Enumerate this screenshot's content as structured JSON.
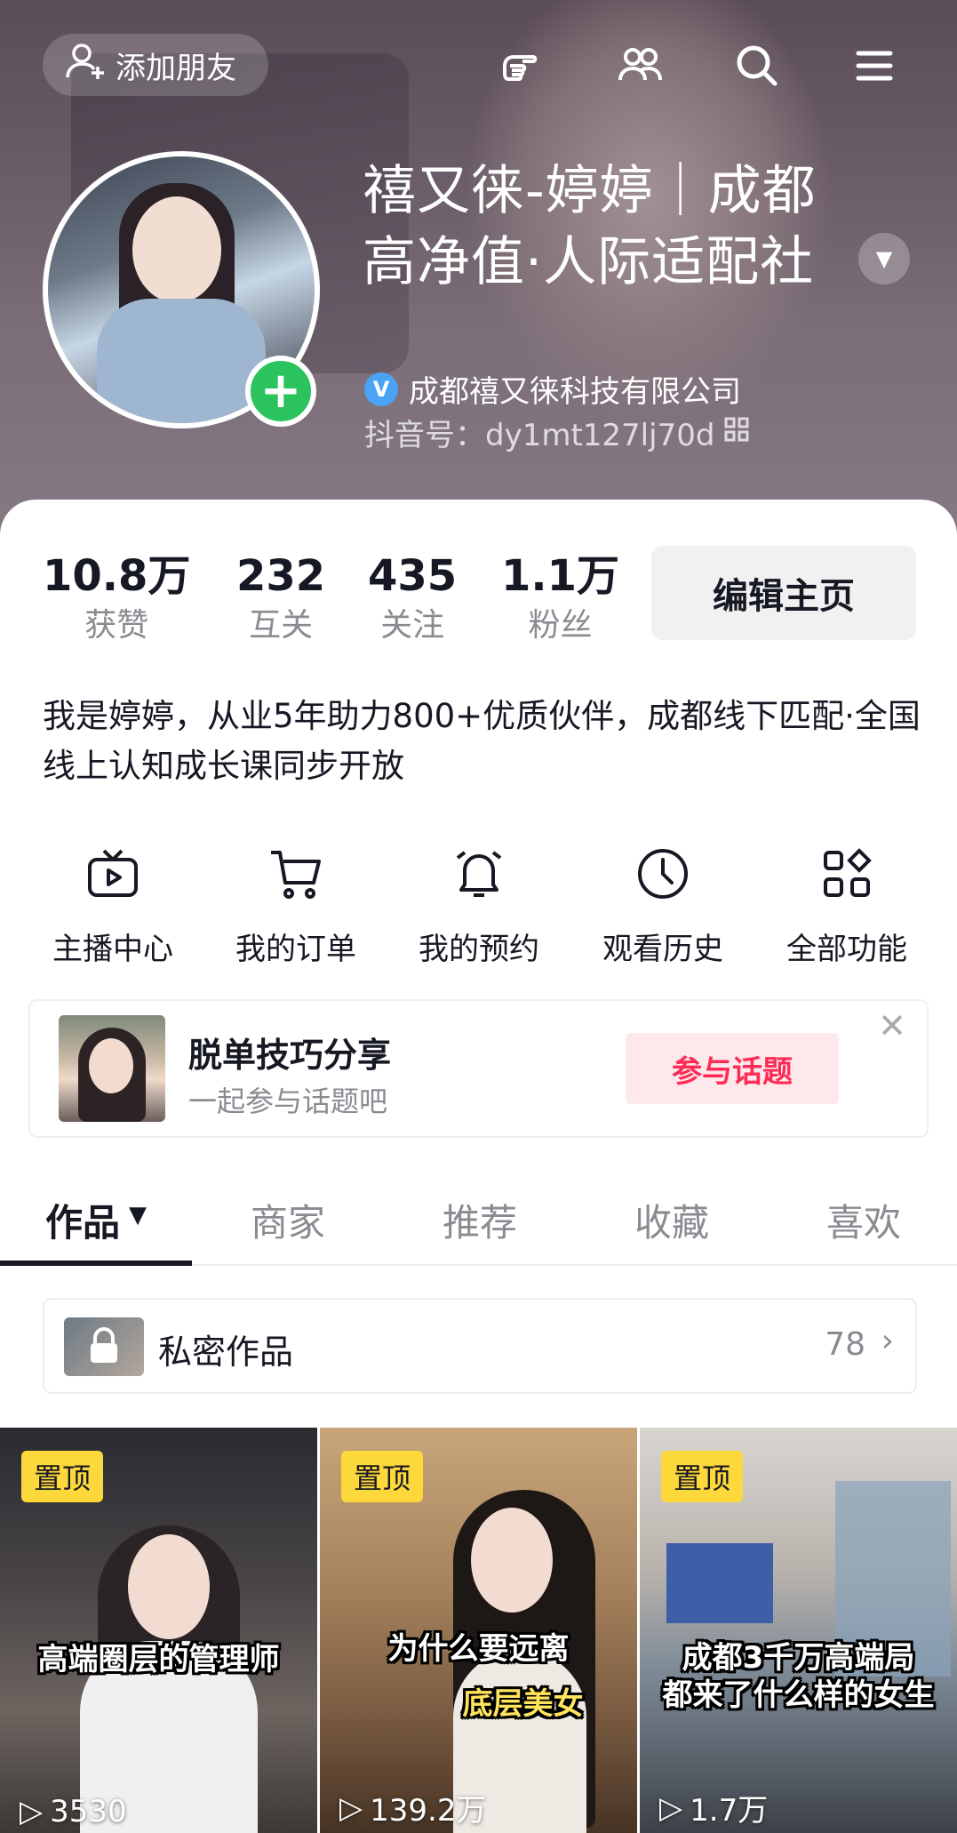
{
  "header": {
    "add_friend_label": "添加朋友",
    "icons": [
      "hand-pointer-icon",
      "friends-icon",
      "search-icon",
      "menu-icon"
    ]
  },
  "profile": {
    "name": "禧又徕-婷婷｜成都高净值·人际适配社",
    "verified_badge": "V",
    "verified_company": "成都禧又徕科技有限公司",
    "douyin_id": "抖音号：dy1mt127lj70d"
  },
  "stats": [
    {
      "value": "10.8万",
      "label": "获赞"
    },
    {
      "value": "232",
      "label": "互关"
    },
    {
      "value": "435",
      "label": "关注"
    },
    {
      "value": "1.1万",
      "label": "粉丝"
    }
  ],
  "edit_button": "编辑主页",
  "bio": "我是婷婷，从业5年助力800+优质伙伴，成都线下匹配·全国线上认知成长课同步开放",
  "features": [
    {
      "label": "主播中心",
      "icon": "tv-play-icon"
    },
    {
      "label": "我的订单",
      "icon": "cart-icon"
    },
    {
      "label": "我的预约",
      "icon": "bell-icon"
    },
    {
      "label": "观看历史",
      "icon": "clock-icon"
    },
    {
      "label": "全部功能",
      "icon": "grid-icon"
    }
  ],
  "topic_card": {
    "title": "脱单技巧分享",
    "subtitle": "一起参与话题吧",
    "button": "参与话题"
  },
  "tabs": [
    {
      "label": "作品",
      "active": true
    },
    {
      "label": "商家"
    },
    {
      "label": "推荐"
    },
    {
      "label": "收藏"
    },
    {
      "label": "喜欢"
    }
  ],
  "private_works": {
    "label": "私密作品",
    "count": "78"
  },
  "videos": [
    {
      "pin": "置顶",
      "caption": "高端圈层的管理师",
      "plays": "3530"
    },
    {
      "pin": "置顶",
      "caption_line1": "为什么要远离",
      "caption_line2": "底层美女",
      "plays": "139.2万"
    },
    {
      "pin": "置顶",
      "caption_line1": "成都3千万高端局",
      "caption_line2": "都来了什么样的女生",
      "plays": "1.7万"
    }
  ],
  "colors": {
    "accent": "#fe2c55",
    "verify": "#4aa3f5",
    "add_green": "#2bc35d",
    "pin_yellow": "#fdd83b"
  }
}
